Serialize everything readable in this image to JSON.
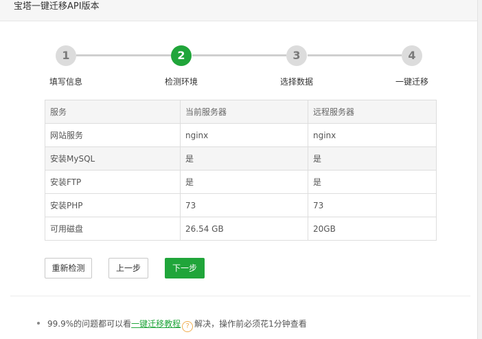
{
  "window": {
    "title": "宝塔一键迁移API版本"
  },
  "steps": [
    {
      "number": "1",
      "label": "填写信息",
      "state": "done"
    },
    {
      "number": "2",
      "label": "检测环境",
      "state": "active"
    },
    {
      "number": "3",
      "label": "选择数据",
      "state": "pending"
    },
    {
      "number": "4",
      "label": "一键迁移",
      "state": "pending"
    }
  ],
  "colors": {
    "accent": "#20a53a",
    "inactive_step": "#dcdcdc",
    "help_icon": "#f0ad4e"
  },
  "table": {
    "headers": [
      "服务",
      "当前服务器",
      "远程服务器"
    ],
    "rows": [
      [
        "网站服务",
        "nginx",
        "nginx"
      ],
      [
        "安装MySQL",
        "是",
        "是"
      ],
      [
        "安装FTP",
        "是",
        "是"
      ],
      [
        "安装PHP",
        "73",
        "73"
      ],
      [
        "可用磁盘",
        "26.54 GB",
        "20GB"
      ]
    ]
  },
  "buttons": {
    "recheck": "重新检测",
    "prev": "上一步",
    "next": "下一步"
  },
  "tips": {
    "prefix": "99.9%的问题都可以看",
    "link": "一键迁移教程",
    "help_icon": "question-icon",
    "suffix": "解决，操作前必须花1分钟查看"
  }
}
